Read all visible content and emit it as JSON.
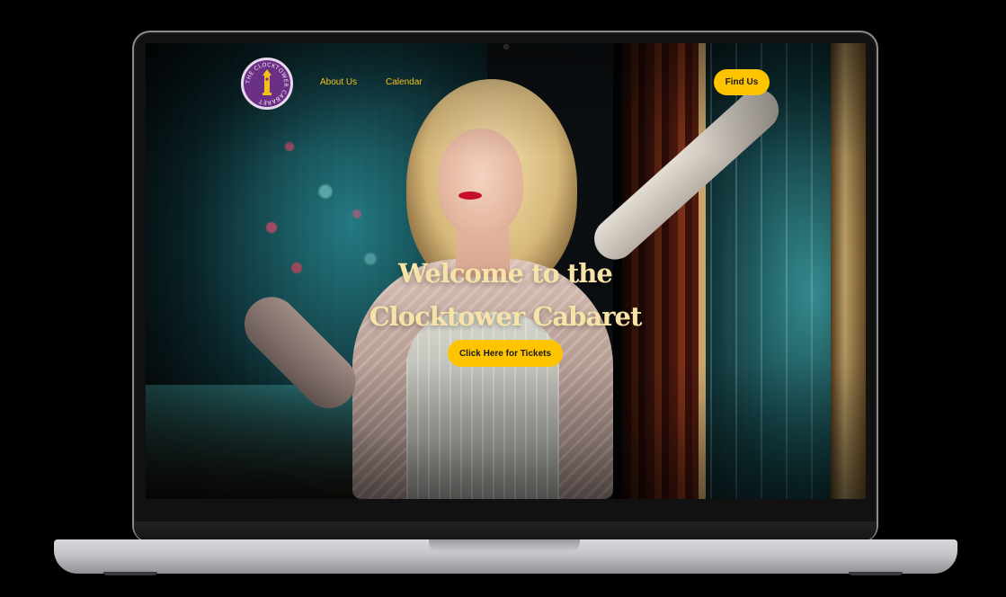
{
  "brand": {
    "logo_text": "THE CLOCKTOWER CABARET",
    "logo_color": "#6b2f86",
    "tower_color": "#f2c21a"
  },
  "nav": {
    "links": [
      {
        "label": "About Us"
      },
      {
        "label": "Calendar"
      }
    ],
    "find_us_label": "Find Us",
    "link_color": "#f2c21a",
    "button_color": "#ffc400"
  },
  "hero": {
    "title_line1": "Welcome to the",
    "title_line2": "Clocktower Cabaret",
    "cta_label": "Click Here for Tickets",
    "title_color": "#f7e2a8"
  }
}
